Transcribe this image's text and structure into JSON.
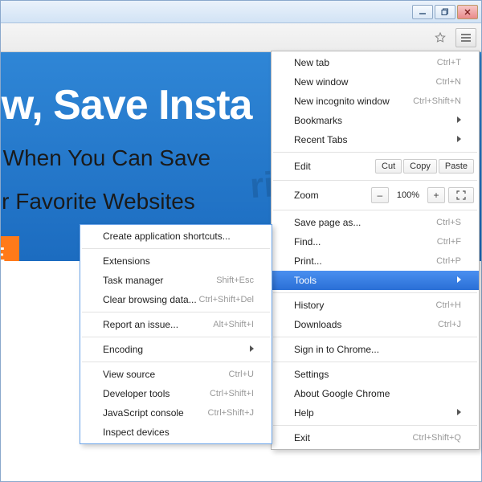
{
  "page": {
    "banner_title": "ow, Save Insta",
    "banner_sub1": "re When You Can Save",
    "banner_sub2": "our Favorite Websites",
    "orange_label": "E",
    "watermark": "risk.com"
  },
  "main_menu": {
    "new_tab": {
      "label": "New tab",
      "shortcut": "Ctrl+T"
    },
    "new_window": {
      "label": "New window",
      "shortcut": "Ctrl+N"
    },
    "new_incognito": {
      "label": "New incognito window",
      "shortcut": "Ctrl+Shift+N"
    },
    "bookmarks": {
      "label": "Bookmarks"
    },
    "recent_tabs": {
      "label": "Recent Tabs"
    },
    "edit": {
      "label": "Edit",
      "cut": "Cut",
      "copy": "Copy",
      "paste": "Paste"
    },
    "zoom": {
      "label": "Zoom",
      "value": "100%"
    },
    "save_page": {
      "label": "Save page as...",
      "shortcut": "Ctrl+S"
    },
    "find": {
      "label": "Find...",
      "shortcut": "Ctrl+F"
    },
    "print": {
      "label": "Print...",
      "shortcut": "Ctrl+P"
    },
    "tools": {
      "label": "Tools"
    },
    "history": {
      "label": "History",
      "shortcut": "Ctrl+H"
    },
    "downloads": {
      "label": "Downloads",
      "shortcut": "Ctrl+J"
    },
    "signin": {
      "label": "Sign in to Chrome..."
    },
    "settings": {
      "label": "Settings"
    },
    "about": {
      "label": "About Google Chrome"
    },
    "help": {
      "label": "Help"
    },
    "exit": {
      "label": "Exit",
      "shortcut": "Ctrl+Shift+Q"
    }
  },
  "tools_menu": {
    "create_shortcuts": {
      "label": "Create application shortcuts..."
    },
    "extensions": {
      "label": "Extensions"
    },
    "task_manager": {
      "label": "Task manager",
      "shortcut": "Shift+Esc"
    },
    "clear_data": {
      "label": "Clear browsing data...",
      "shortcut": "Ctrl+Shift+Del"
    },
    "report_issue": {
      "label": "Report an issue...",
      "shortcut": "Alt+Shift+I"
    },
    "encoding": {
      "label": "Encoding"
    },
    "view_source": {
      "label": "View source",
      "shortcut": "Ctrl+U"
    },
    "dev_tools": {
      "label": "Developer tools",
      "shortcut": "Ctrl+Shift+I"
    },
    "js_console": {
      "label": "JavaScript console",
      "shortcut": "Ctrl+Shift+J"
    },
    "inspect_devices": {
      "label": "Inspect devices"
    }
  }
}
